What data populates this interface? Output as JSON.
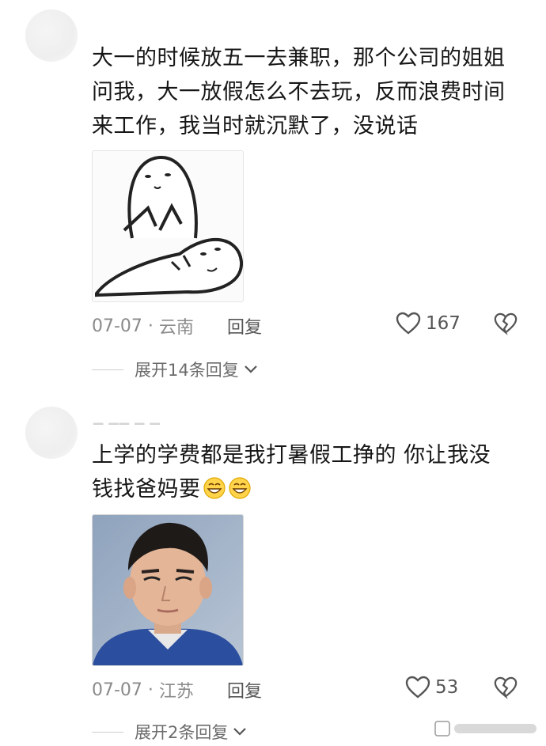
{
  "comments": [
    {
      "text": "大一的时候放五一去兼职，那个公司的姐姐问我，大一放假怎么不去玩，反而浪费时间来工作，我当时就沉默了，没说话",
      "image": "sticker-meme",
      "date": "07-07",
      "location": "云南",
      "reply_label": "回复",
      "likes": "167",
      "expand_label": "展开14条回复"
    },
    {
      "text": "上学的学费都是我打暑假工挣的 你让我没钱找爸妈要",
      "emoji_count": 2,
      "image": "portrait-photo",
      "date": "07-07",
      "location": "江苏",
      "reply_label": "回复",
      "likes": "53",
      "expand_label": "展开2条回复"
    }
  ],
  "colors": {
    "text": "#161616",
    "meta": "#8a8a8a",
    "icon": "#555555",
    "divider": "#d0d0d0"
  },
  "icons": [
    "heart-icon",
    "broken-heart-icon",
    "chevron-down-icon",
    "smile-emoji-icon"
  ]
}
